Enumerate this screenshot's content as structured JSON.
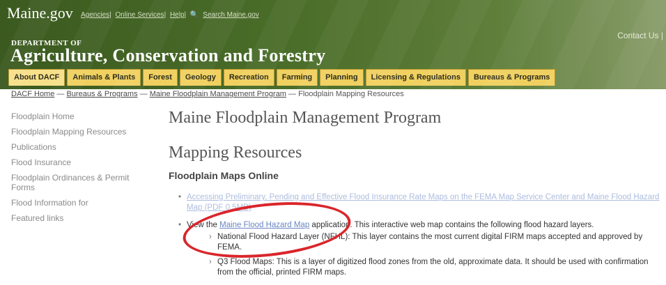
{
  "header": {
    "logo": "Maine.gov",
    "links": [
      "Agencies",
      "Online Services",
      "Help"
    ],
    "search_label": "Search Maine.gov",
    "contact": "Contact Us |",
    "dept_label": "DEPARTMENT OF",
    "agency_title": "Agriculture, Conservation and Forestry",
    "tabs": [
      "About DACF",
      "Animals & Plants",
      "Forest",
      "Geology",
      "Recreation",
      "Farming",
      "Planning",
      "Licensing & Regulations",
      "Bureaus & Programs"
    ]
  },
  "breadcrumb": {
    "items": [
      "DACF Home",
      "Bureaus & Programs",
      "Maine Floodplain Management Program"
    ],
    "sep": " — ",
    "current": "Floodplain Mapping Resources"
  },
  "sidebar": {
    "items": [
      "Floodplain Home",
      "Floodplain Mapping Resources",
      "Publications",
      "Flood Insurance",
      "Floodplain Ordinances & Permit Forms",
      "Flood Information for",
      "Featured links"
    ]
  },
  "main": {
    "title": "Maine Floodplain Management Program",
    "subtitle": "Mapping Resources",
    "section": "Floodplain Maps Online",
    "bullet1_link": "Accessing Preliminary, Pending and Effective Flood Insurance Rate Maps on the FEMA Map Service Center and Maine Flood Hazard Map (PDF 0.5MB)",
    "bullet2_prefix": "View the ",
    "bullet2_link": "Maine Flood Hazard Map",
    "bullet2_suffix": " application. This interactive web map contains the following flood hazard layers.",
    "sub1": "National Flood Hazard Layer (NFHL): This layer contains the most current digital FIRM maps accepted and approved by FEMA.",
    "sub2": "Q3 Flood Maps: This is a layer of digitized flood zones from the old, approximate data. It should be used with confirmation from the official, printed FIRM maps."
  },
  "colors": {
    "annotation_circle": "#d9262b",
    "tab_bg": "#f0d060",
    "header_bg": "#4b6e2a"
  }
}
